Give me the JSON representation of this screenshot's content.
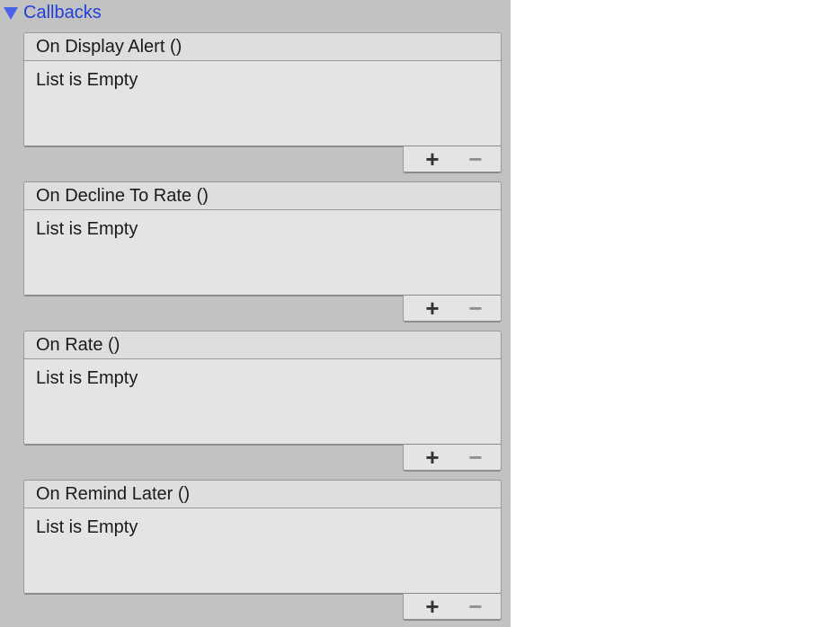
{
  "section": {
    "title": "Callbacks",
    "expanded": true
  },
  "events": [
    {
      "name": "On Display Alert ()",
      "empty_label": "List is Empty"
    },
    {
      "name": "On Decline To Rate ()",
      "empty_label": "List is Empty"
    },
    {
      "name": "On Rate ()",
      "empty_label": "List is Empty"
    },
    {
      "name": "On Remind Later ()",
      "empty_label": "List is Empty"
    }
  ],
  "controls": {
    "add_symbol": "+",
    "remove_symbol": "−"
  },
  "colors": {
    "panel_background": "#c2c2c2",
    "foldout_text": "#2340d9",
    "header_background": "#dedede",
    "body_background": "#e4e4e4"
  }
}
